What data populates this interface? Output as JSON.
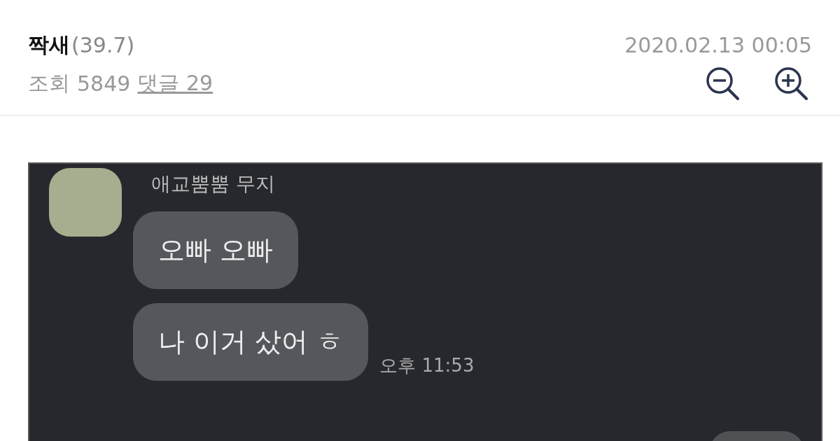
{
  "post": {
    "author": "짝새",
    "author_level": "(39.7)",
    "date": "2020.02.13 00:05",
    "views_label": "조회",
    "views": "5849",
    "comments_link": "댓글 29"
  },
  "chat": {
    "sender": "애교뿜뿜 무지",
    "messages": [
      {
        "kind": "received",
        "text": "오빠 오빠"
      },
      {
        "kind": "received",
        "text": "나 이거 샀어 ㅎ",
        "time": "오후 11:53"
      },
      {
        "kind": "sent"
      }
    ]
  }
}
